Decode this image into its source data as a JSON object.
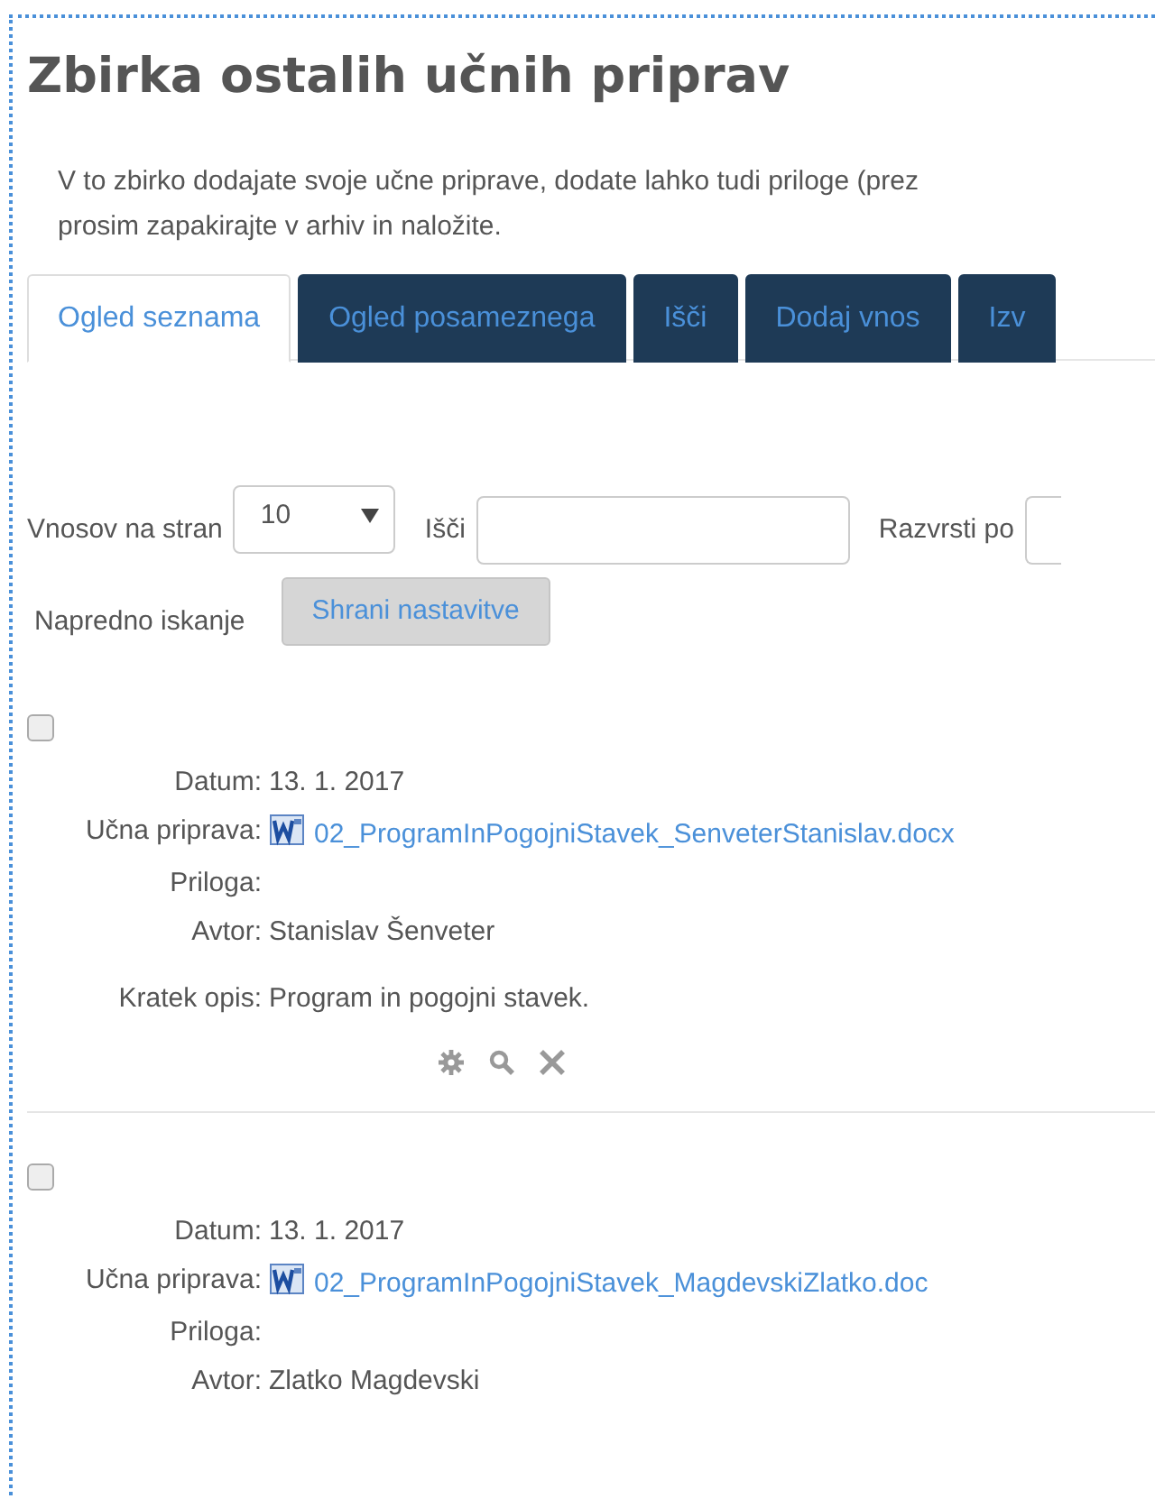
{
  "title": "Zbirka ostalih učnih priprav",
  "description": [
    "V to zbirko dodajate svoje učne priprave, dodate lahko tudi priloge (prez",
    "prosim zapakirajte v arhiv in naložite."
  ],
  "tabs": [
    {
      "label": "Ogled seznama",
      "selected": true
    },
    {
      "label": "Ogled posameznega",
      "selected": false
    },
    {
      "label": "Išči",
      "selected": false
    },
    {
      "label": "Dodaj vnos",
      "selected": false
    },
    {
      "label": "Izv",
      "selected": false
    }
  ],
  "filters": {
    "per_page_label": "Vnosov na stran",
    "per_page_value": "10",
    "search_label": "Išči",
    "sort_label": "Razvrsti po",
    "advanced_label": "Napredno iskanje",
    "save_button": "Shrani nastavitve"
  },
  "entries": [
    {
      "checked": false,
      "fields": [
        {
          "label": "Datum:",
          "value": "13. 1. 2017",
          "kind": "text"
        },
        {
          "label": "Učna priprava:",
          "value": "02_ProgramInPogojniStavek_SenveterStanislav.docx",
          "kind": "file"
        },
        {
          "label": "Priloga:"
        },
        {
          "label": "Avtor:",
          "value": "Stanislav Šenveter",
          "kind": "text"
        },
        {
          "label": "Kratek opis:",
          "value": "Program in pogojni stavek.",
          "kind": "text"
        }
      ],
      "actions": true
    },
    {
      "checked": false,
      "fields": [
        {
          "label": "Datum:",
          "value": "13. 1. 2017",
          "kind": "text"
        },
        {
          "label": "Učna priprava:",
          "value": "02_ProgramInPogojniStavek_MagdevskiZlatko.doc",
          "kind": "file"
        },
        {
          "label": "Priloga:"
        },
        {
          "label": "Avtor:",
          "value": "Zlatko Magdevski",
          "kind": "text"
        }
      ],
      "actions": false
    }
  ]
}
